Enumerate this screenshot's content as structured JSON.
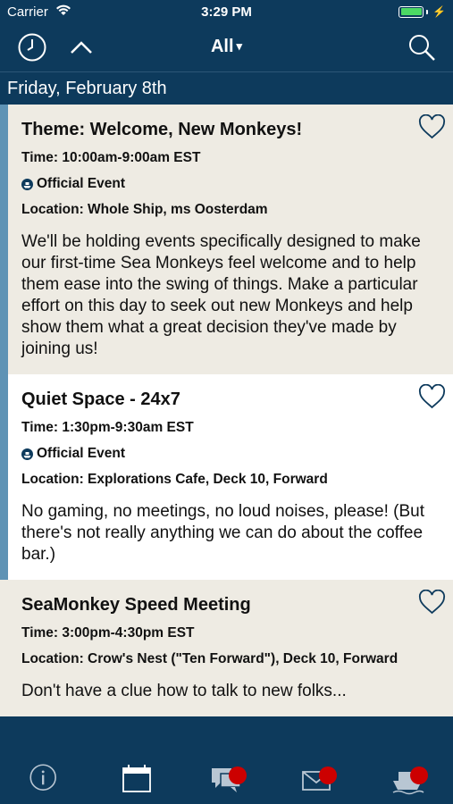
{
  "status_bar": {
    "carrier": "Carrier",
    "time": "3:29 PM"
  },
  "nav": {
    "filter_label": "All",
    "filter_caret": "▾"
  },
  "date_header": "Friday, February 8th",
  "events": [
    {
      "title": "Theme: Welcome, New Monkeys!",
      "time": "Time: 10:00am-9:00am EST",
      "official": "Official Event",
      "location": "Location: Whole Ship, ms Oosterdam",
      "description": "We'll be holding events specifically designed to make our first-time Sea Monkeys feel welcome and to help them ease into the swing of things. Make a particular effort on this day to seek out new Monkeys and help show them what a great decision they've made by joining us!"
    },
    {
      "title": "Quiet Space - 24x7",
      "time": "Time: 1:30pm-9:30am EST",
      "official": "Official Event",
      "location": "Location: Explorations Cafe, Deck 10, Forward",
      "description": "No gaming, no meetings, no loud noises, please! (But there's not really anything we can do about the coffee bar.)"
    },
    {
      "title": "SeaMonkey Speed Meeting",
      "time": "Time: 3:00pm-4:30pm EST",
      "location": "Location: Crow's Nest (\"Ten Forward\"), Deck 10, Forward",
      "description": "Don't have a clue how to talk to new folks..."
    }
  ],
  "colors": {
    "navy": "#0d3a5c",
    "card_alt": "#eeebe3",
    "stripe": "#5f93b5",
    "badge": "#cc0000"
  },
  "icons": {
    "clock": "clock-icon",
    "up": "chevron-up-icon",
    "search": "search-icon",
    "heart": "heart-icon",
    "ship": "ship-icon",
    "info": "info-icon",
    "calendar": "calendar-icon",
    "chat": "chat-icon",
    "mail": "mail-icon",
    "boat": "ship-icon"
  }
}
